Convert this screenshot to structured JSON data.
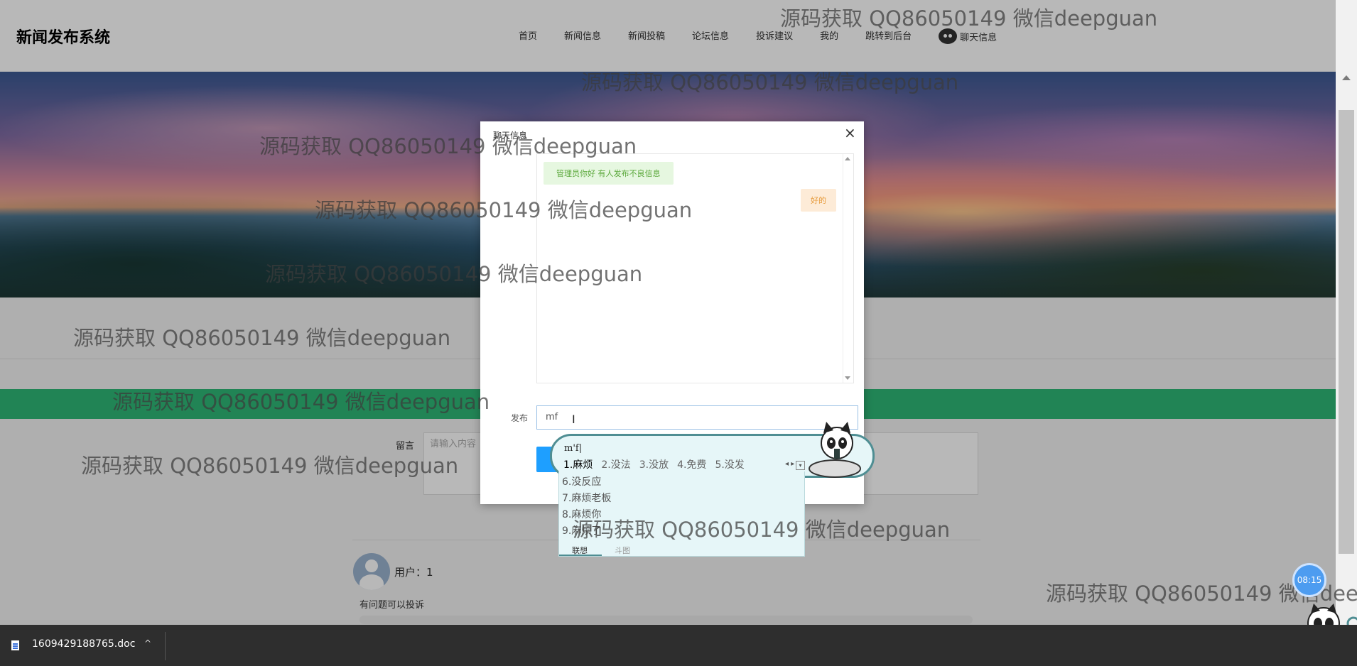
{
  "header": {
    "logo": "新闻发布系统",
    "nav": [
      "首页",
      "新闻信息",
      "新闻投稿",
      "论坛信息",
      "投诉建议",
      "我的",
      "跳转到后台"
    ],
    "chat_nav": "聊天信息"
  },
  "comment_form": {
    "label": "留言",
    "placeholder": "请输入内容"
  },
  "comments": [
    {
      "user": "用户：1",
      "text": "有问题可以投诉"
    }
  ],
  "modal": {
    "title": "聊天信息",
    "close": "×",
    "messages": [
      {
        "side": "left",
        "text": "管理员你好 有人发布不良信息"
      },
      {
        "side": "right",
        "text": "好的"
      }
    ],
    "publish_label": "发布",
    "input_value": "mf",
    "cursor_glyph": "I"
  },
  "ime": {
    "pinyin": "m'f|",
    "candidates": [
      "1.麻烦",
      "2.没法",
      "3.没放",
      "4.免费",
      "5.没发"
    ],
    "more_candidates": [
      "6.没反应",
      "7.麻烦老板",
      "8.麻烦你",
      "9.麻烦了"
    ],
    "tabs": [
      "联想",
      "斗图"
    ],
    "arrows": "◂ ▸",
    "expand": "▾"
  },
  "watermark_text": "源码获取 QQ86050149 微信deepguan",
  "clock": "08:15",
  "download": {
    "filename": "1609429188765.doc",
    "chevron": "^"
  },
  "colors": {
    "accent_green": "#2fb777",
    "button_blue": "#1e9fff"
  }
}
